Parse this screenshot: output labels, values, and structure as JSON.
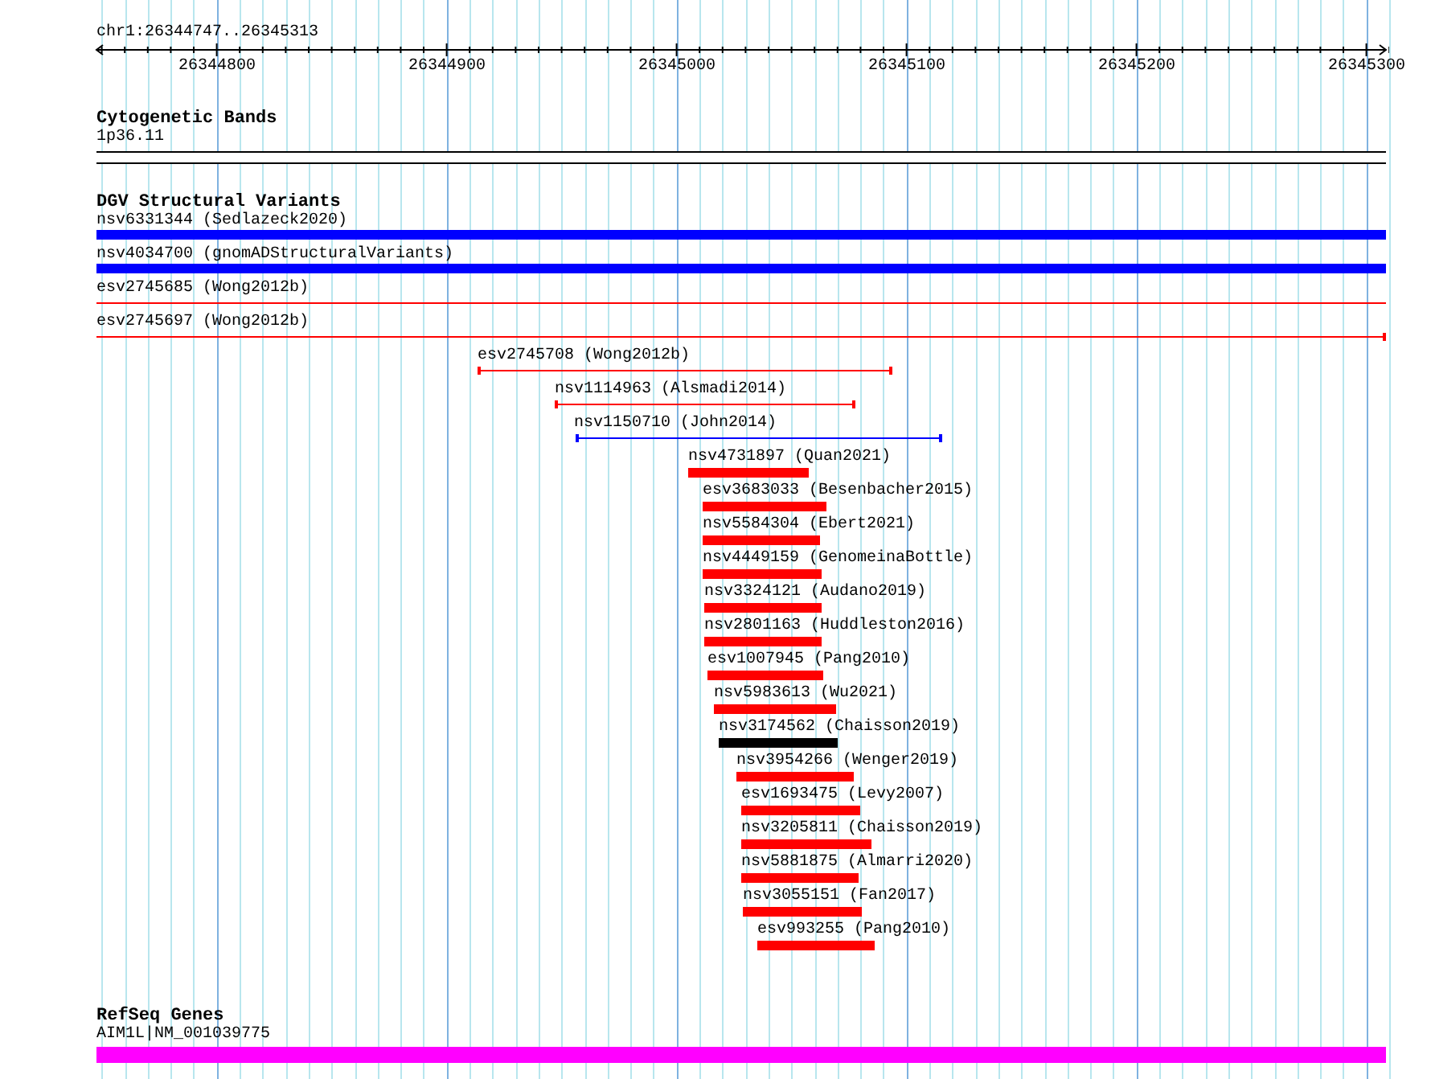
{
  "ruler": {
    "location": "chr1:26344747..26345313",
    "ticks": [
      "26344800",
      "26344900",
      "26345000",
      "26345100",
      "26345200",
      "26345300"
    ]
  },
  "tracks": [
    {
      "title": "Cytogenetic Bands",
      "kind": "band",
      "features": [
        {
          "label": "1p36.11",
          "kind": "band",
          "color": "#ffffff"
        }
      ]
    },
    {
      "title": "DGV Structural Variants",
      "kind": "variants",
      "features": [
        {
          "label": "nsv6331344 (Sedlazeck2020)",
          "kind": "thick",
          "color": "#0000ff"
        },
        {
          "label": "nsv4034700 (gnomADStructuralVariants)",
          "kind": "thick",
          "color": "#0000ff"
        },
        {
          "label": "esv2745685 (Wong2012b)",
          "kind": "line",
          "color": "#ff0000"
        },
        {
          "label": "esv2745697 (Wong2012b)",
          "kind": "line",
          "color": "#ff0000"
        },
        {
          "label": "esv2745708 (Wong2012b)",
          "kind": "line",
          "color": "#ff0000"
        },
        {
          "label": "nsv1114963 (Alsmadi2014)",
          "kind": "line",
          "color": "#ff0000"
        },
        {
          "label": "nsv1150710 (John2014)",
          "kind": "line",
          "color": "#0000ff"
        },
        {
          "label": "nsv4731897 (Quan2021)",
          "kind": "thick",
          "color": "#ff0000"
        },
        {
          "label": "esv3683033 (Besenbacher2015)",
          "kind": "thick",
          "color": "#ff0000"
        },
        {
          "label": "nsv5584304 (Ebert2021)",
          "kind": "thick",
          "color": "#ff0000"
        },
        {
          "label": "nsv4449159 (GenomeinaBottle)",
          "kind": "thick",
          "color": "#ff0000"
        },
        {
          "label": "nsv3324121 (Audano2019)",
          "kind": "thick",
          "color": "#ff0000"
        },
        {
          "label": "nsv2801163 (Huddleston2016)",
          "kind": "thick",
          "color": "#ff0000"
        },
        {
          "label": "esv1007945 (Pang2010)",
          "kind": "thick",
          "color": "#ff0000"
        },
        {
          "label": "nsv5983613 (Wu2021)",
          "kind": "thick",
          "color": "#ff0000"
        },
        {
          "label": "nsv3174562 (Chaisson2019)",
          "kind": "thick",
          "color": "#000000"
        },
        {
          "label": "nsv3954266 (Wenger2019)",
          "kind": "thick",
          "color": "#ff0000"
        },
        {
          "label": "esv1693475 (Levy2007)",
          "kind": "thick",
          "color": "#ff0000"
        },
        {
          "label": "nsv3205811 (Chaisson2019)",
          "kind": "thick",
          "color": "#ff0000"
        },
        {
          "label": "nsv5881875 (Almarri2020)",
          "kind": "thick",
          "color": "#ff0000"
        },
        {
          "label": "nsv3055151 (Fan2017)",
          "kind": "thick",
          "color": "#ff0000"
        },
        {
          "label": "esv993255 (Pang2010)",
          "kind": "thick",
          "color": "#ff0000"
        }
      ]
    },
    {
      "title": "RefSeq Genes",
      "kind": "genes",
      "features": [
        {
          "label": "AIM1L|NM_001039775",
          "kind": "gene",
          "color": "#ff00ff"
        }
      ]
    }
  ]
}
